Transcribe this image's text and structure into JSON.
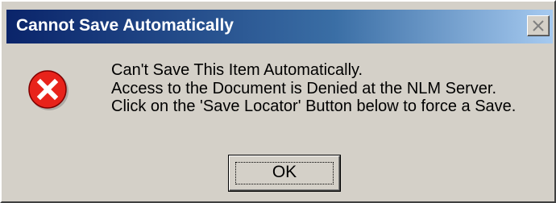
{
  "window": {
    "title": "Cannot Save Automatically",
    "close_icon": "close-icon"
  },
  "message": {
    "icon": "error-icon",
    "lines": [
      "Can't Save This Item Automatically.",
      "Access to the Document is Denied at the NLM Server.",
      "Click on the 'Save Locator' Button below to force a Save."
    ]
  },
  "buttons": {
    "ok_label": "OK"
  },
  "colors": {
    "dialog_face": "#d4d0c8",
    "titlebar_start": "#0a246a",
    "titlebar_end": "#a6caf0",
    "error_red": "#e8231b"
  }
}
